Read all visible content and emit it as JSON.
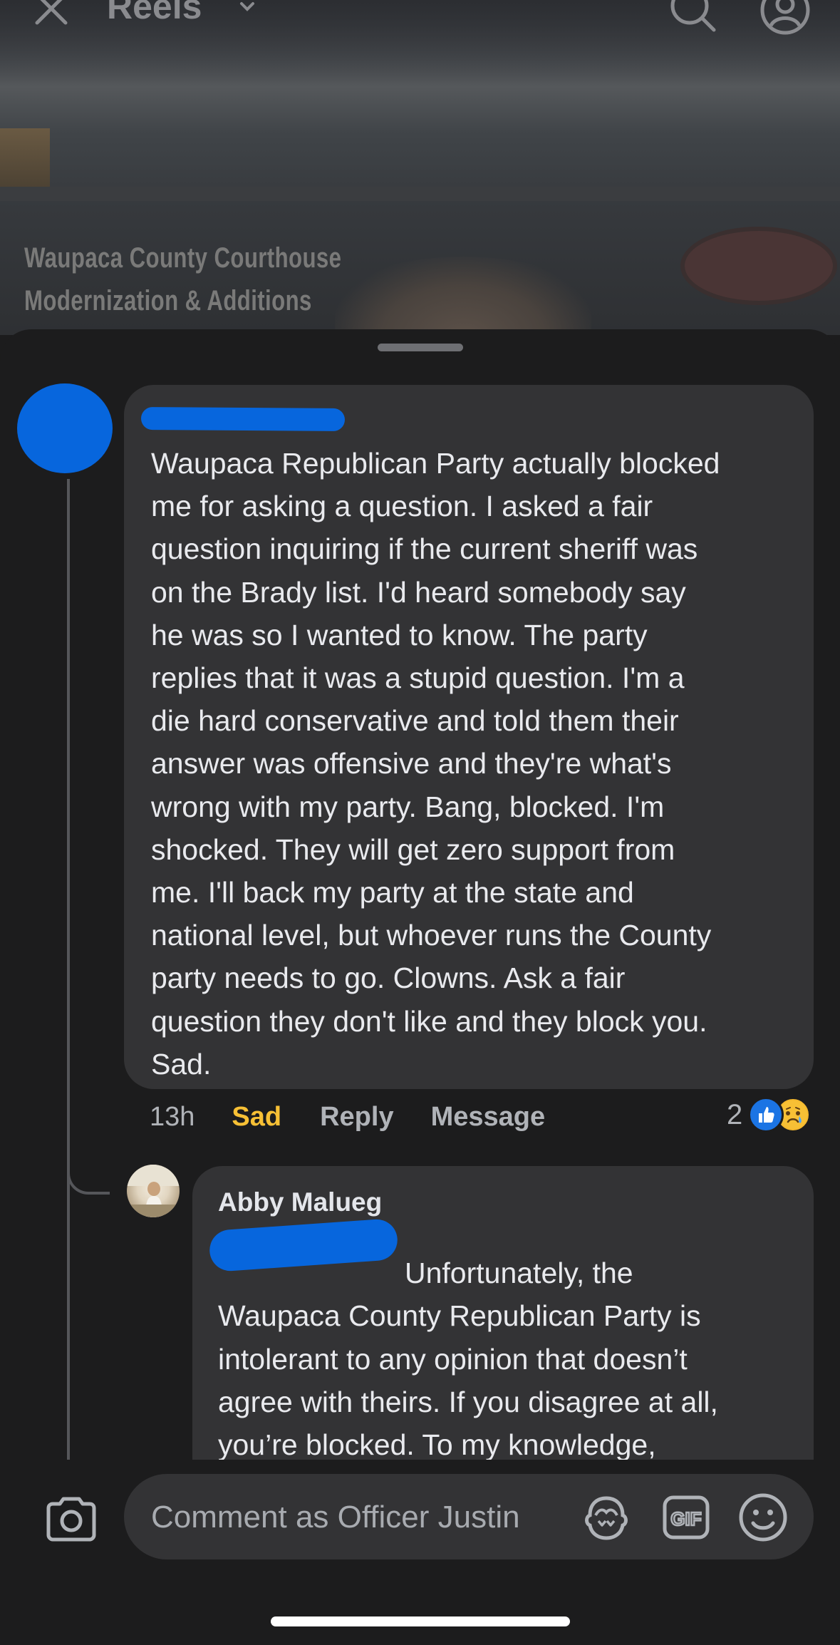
{
  "header": {
    "title": "Reels"
  },
  "video": {
    "sign_line1": "Waupaca County Courthouse",
    "sign_line2": "Modernization & Additions"
  },
  "comment": {
    "body": "Waupaca Republican Party actually blocked\nme for asking a question.  I asked a fair\nquestion inquiring if the current sheriff was\non the Brady list.  I'd heard somebody say\nhe was so I wanted to know.  The party\nreplies that it was a stupid question.  I'm a\ndie hard conservative and told them their\nanswer was offensive and they're what's\nwrong with my party.  Bang, blocked.  I'm\nshocked.  They will get zero support from\nme.  I'll back my party at the state and\nnational level, but whoever runs the County\nparty needs to go.  Clowns.  Ask a fair\nquestion they don't like and they block you.\nSad.",
    "time": "13h",
    "reaction_label": "Sad",
    "reply_label": "Reply",
    "message_label": "Message",
    "reaction_count": "2",
    "colors": {
      "reaction_sad": "#f7c035",
      "like": "#1b74e4",
      "redaction": "#0766dd"
    }
  },
  "reply": {
    "author": "Abby Malueg",
    "body_first": "Unfortunately, the",
    "body_rest": "Waupaca County Republican Party is\nintolerant to any opinion that doesn’t\nagree with theirs. If you disagree at all,\nyou’re blocked. To my knowledge,\nthere is two that run the Facebook"
  },
  "composer": {
    "placeholder": "Comment as Officer Justin"
  },
  "icons": [
    "close-icon",
    "chevron-down-icon",
    "search-icon",
    "profile-icon",
    "camera-icon",
    "avatar-sticker-icon",
    "gif-icon",
    "emoji-icon",
    "like-reaction-icon",
    "sad-reaction-icon"
  ]
}
